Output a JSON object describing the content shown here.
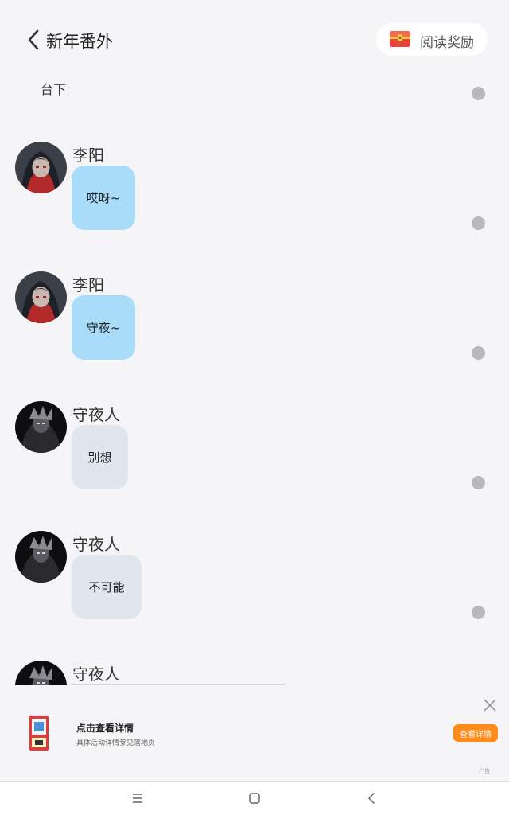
{
  "header": {
    "title": "新年番外",
    "reward_label": "阅读奖励"
  },
  "chat": {
    "narration": "台下",
    "messages": [
      {
        "sender": "李阳",
        "text": "哎呀~",
        "style": "blue",
        "avatar": "hooded-character-avatar"
      },
      {
        "sender": "李阳",
        "text": "守夜~",
        "style": "blue",
        "avatar": "hooded-character-avatar"
      },
      {
        "sender": "守夜人",
        "text": "别想",
        "style": "gray",
        "avatar": "dark-armored-character-avatar"
      },
      {
        "sender": "守夜人",
        "text": "不可能",
        "style": "gray",
        "avatar": "dark-armored-character-avatar"
      },
      {
        "sender": "守夜人",
        "text": "",
        "style": "gray",
        "avatar": "dark-armored-character-avatar"
      }
    ]
  },
  "ad": {
    "title": "点击查看详情",
    "subtitle": "具体活动详情参见落地页",
    "button_label": "查看详情",
    "tag": "广告"
  },
  "colors": {
    "background": "#f5f5f7",
    "bubble_blue": "#a8dcf8",
    "bubble_gray": "#e0e5ee",
    "ad_button": "#ff8c1a",
    "reward_icon": "#e8453c"
  },
  "icons": {
    "back": "chevron-left-icon",
    "reward": "treasure-chest-icon",
    "ad_close": "close-icon",
    "nav_menu": "menu-icon",
    "nav_home": "home-square-icon",
    "nav_back": "back-triangle-icon"
  }
}
